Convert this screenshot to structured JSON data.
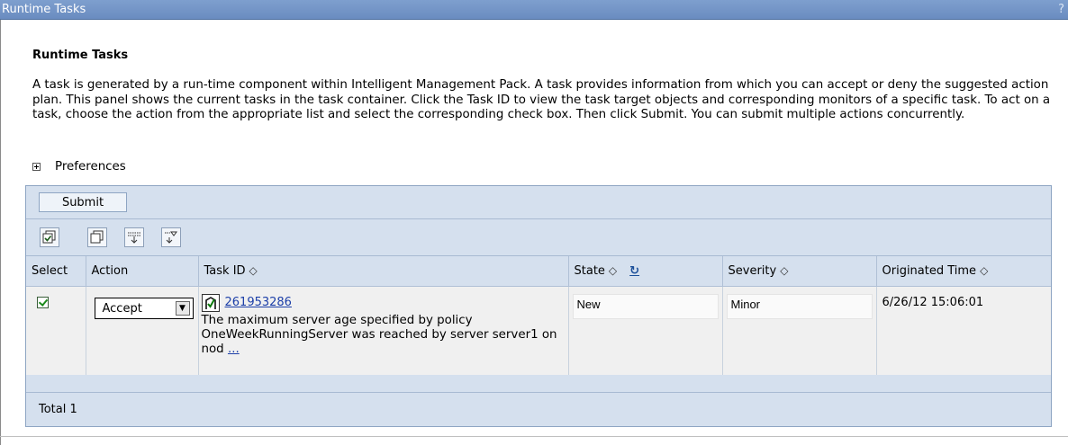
{
  "window": {
    "title": "Runtime Tasks",
    "help": "?"
  },
  "page": {
    "heading": "Runtime Tasks",
    "description": "A task is generated by a run-time component within Intelligent Management Pack. A task provides information from which you can accept or deny the suggested action plan. This panel shows the current tasks in the task container. Click the Task ID to view the task target objects and corresponding monitors of a specific task. To act on a task, choose the action from the appropriate list and select the corresponding check box. Then click Submit. You can submit multiple actions concurrently.",
    "preferences_label": "Preferences"
  },
  "toolbar": {
    "submit_label": "Submit",
    "icons": [
      "select-all-icon",
      "deselect-all-icon",
      "show-filter-icon",
      "clear-filter-icon"
    ]
  },
  "table": {
    "columns": {
      "select": "Select",
      "action": "Action",
      "task_id": "Task ID",
      "state": "State",
      "severity": "Severity",
      "originated": "Originated Time"
    },
    "sort_glyph": "◇",
    "rows": [
      {
        "selected": true,
        "action": "Accept",
        "task_id": "261953286",
        "description": "The maximum server age specified by policy OneWeekRunningServer was reached by server server1 on nod",
        "more": "...",
        "state": "New",
        "severity": "Minor",
        "originated": "6/26/12 15:06:01"
      }
    ],
    "total_label": "Total 1"
  },
  "colors": {
    "titlebar": "#6a8cc0",
    "panel": "#d5e0ee",
    "link": "#1c3fa8"
  }
}
